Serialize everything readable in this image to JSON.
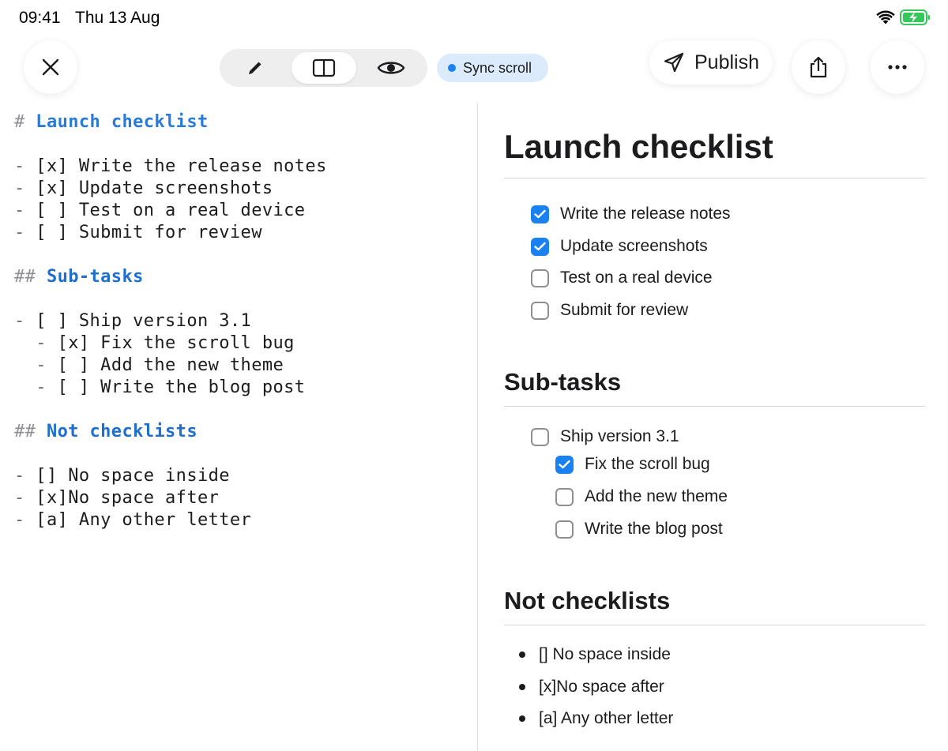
{
  "status_bar": {
    "time": "09:41",
    "date": "Thu 13 Aug"
  },
  "toolbar": {
    "close_icon": "close-icon",
    "modes": [
      {
        "name": "edit",
        "icon": "pencil-icon",
        "selected": false
      },
      {
        "name": "split",
        "icon": "split-view-icon",
        "selected": true
      },
      {
        "name": "preview",
        "icon": "eye-icon",
        "selected": false
      }
    ],
    "sync_label": "Sync scroll",
    "publish_label": "Publish",
    "share_icon": "share-icon",
    "more_icon": "ellipsis-icon"
  },
  "colors": {
    "accent": "#1a82f0",
    "heading_md": "#2a7bd6",
    "sync_bg": "#dcebfb"
  },
  "editor": {
    "lines": [
      {
        "mark": "# ",
        "text": "Launch checklist"
      },
      {
        "dash": "- ",
        "text": "[x] Write the release notes"
      },
      {
        "dash": "- ",
        "text": "[x] Update screenshots"
      },
      {
        "dash": "- ",
        "text": "[ ] Test on a real device"
      },
      {
        "dash": "- ",
        "text": "[ ] Submit for review"
      },
      {
        "mark": "## ",
        "text": "Sub-tasks"
      },
      {
        "dash": "- ",
        "text": "[ ] Ship version 3.1"
      },
      {
        "dash": "  - ",
        "text": "[x] Fix the scroll bug"
      },
      {
        "dash": "  - ",
        "text": "[ ] Add the new theme"
      },
      {
        "dash": "  - ",
        "text": "[ ] Write the blog post"
      },
      {
        "mark": "## ",
        "text": "Not checklists"
      },
      {
        "dash": "- ",
        "text": "[] No space inside"
      },
      {
        "dash": "- ",
        "text": "[x]No space after"
      },
      {
        "dash": "- ",
        "text": "[a] Any other letter"
      }
    ]
  },
  "preview": {
    "h1": "Launch checklist",
    "tasks": [
      {
        "label": "Write the release notes",
        "checked": true
      },
      {
        "label": "Update screenshots",
        "checked": true
      },
      {
        "label": "Test on a real device",
        "checked": false
      },
      {
        "label": "Submit for review",
        "checked": false
      }
    ],
    "h2_subtasks": "Sub-tasks",
    "subtasks": [
      {
        "label": "Ship version 3.1",
        "checked": false
      },
      {
        "label": "Fix the scroll bug",
        "checked": true
      },
      {
        "label": "Add the new theme",
        "checked": false
      },
      {
        "label": "Write the blog post",
        "checked": false
      }
    ],
    "h2_not": "Not checklists",
    "bullets": [
      {
        "label": "[] No space inside"
      },
      {
        "label": "[x]No space after"
      },
      {
        "label": "[a] Any other letter"
      }
    ]
  }
}
